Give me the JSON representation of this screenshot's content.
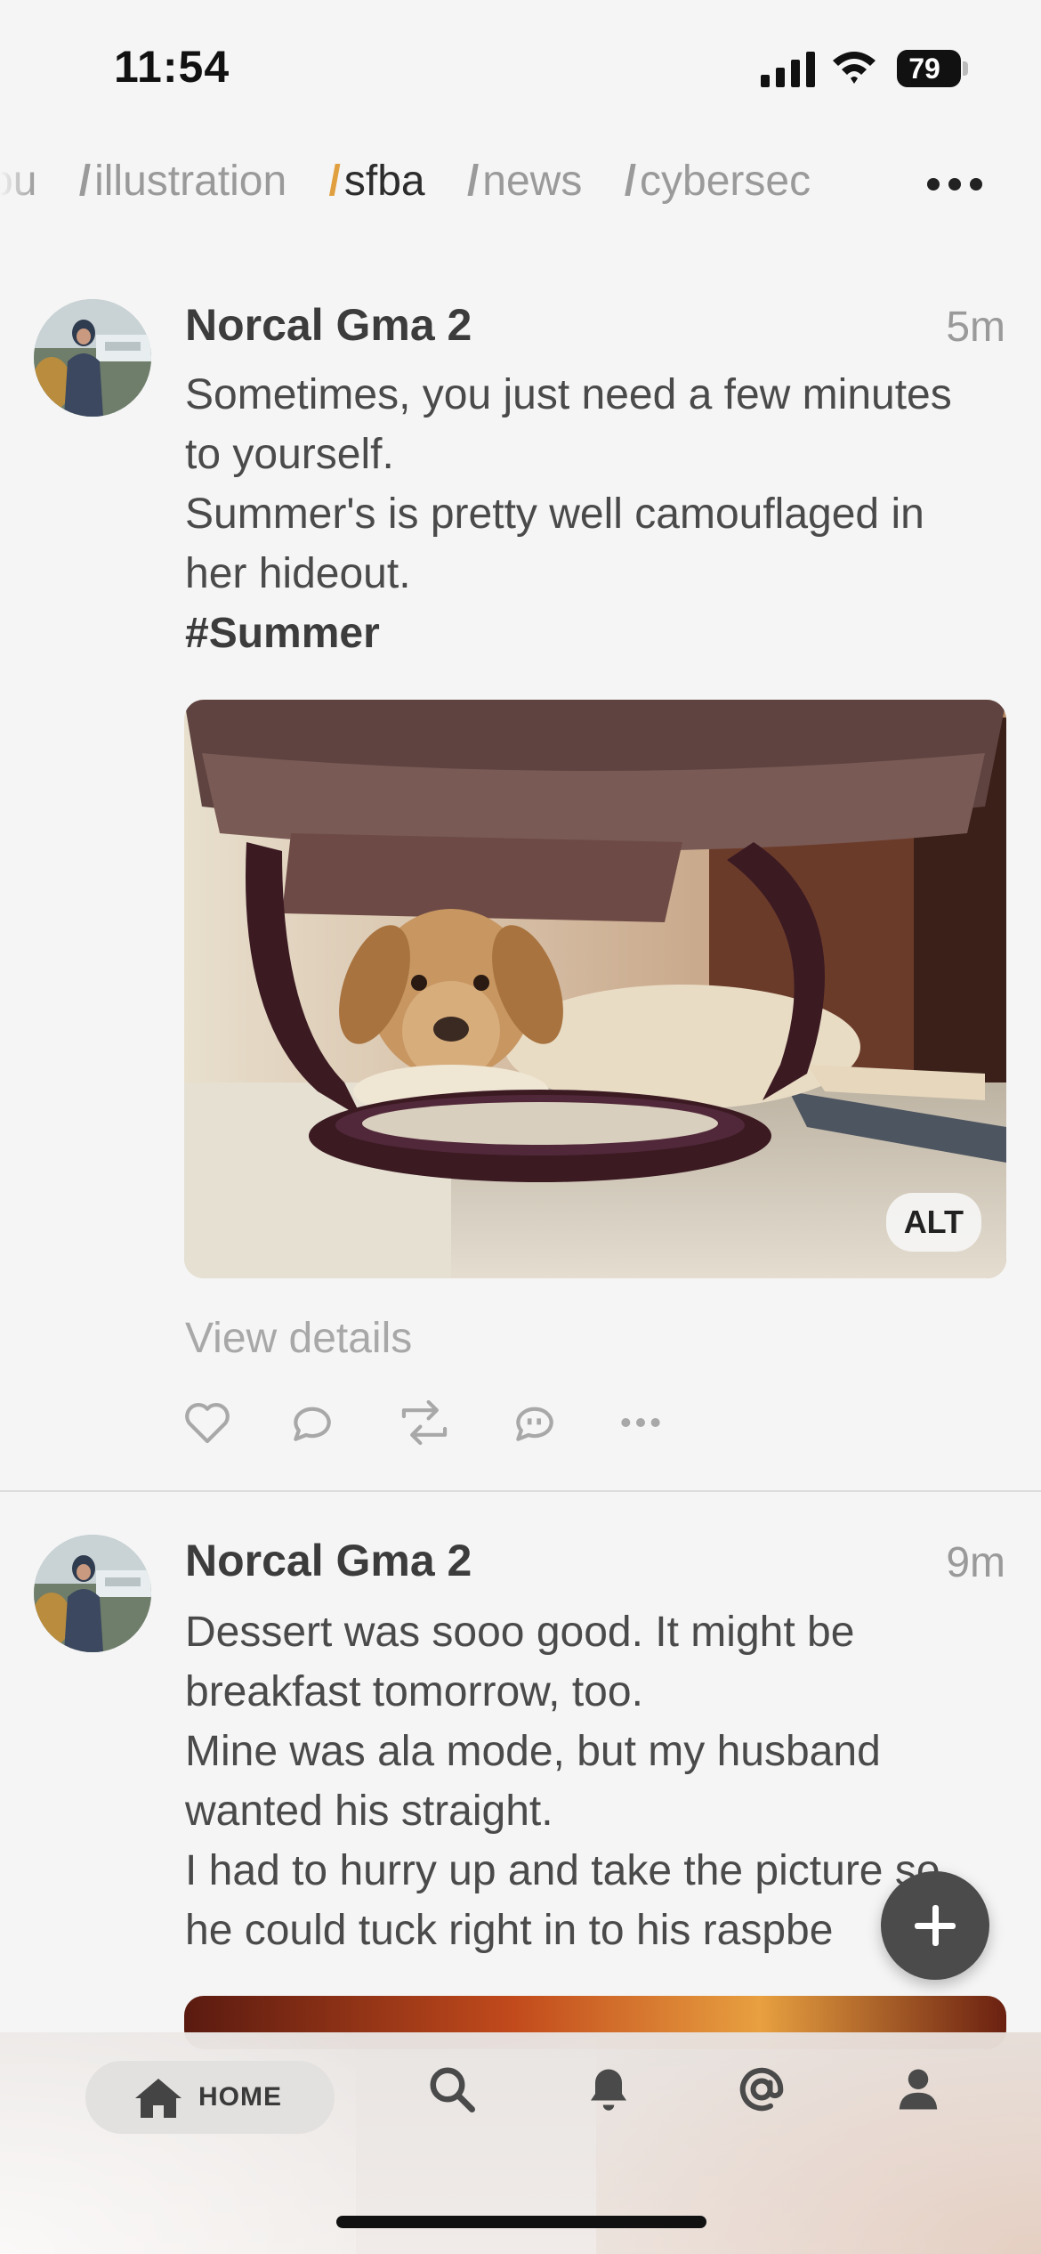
{
  "status_bar": {
    "time": "11:54",
    "battery": "79"
  },
  "feed_tabs": [
    {
      "label": "ou",
      "active": false
    },
    {
      "label": "illustration",
      "active": false
    },
    {
      "label": "sfba",
      "active": true
    },
    {
      "label": "news",
      "active": false
    },
    {
      "label": "cybersec",
      "active": false
    }
  ],
  "feed_tabs_more_icon": "more-horizontal-icon",
  "posts": [
    {
      "author": "Norcal Gma 2",
      "time": "5m",
      "lines": [
        "Sometimes, you just need a few minutes",
        "to yourself.",
        "Summer's is pretty well camouflaged in",
        "her hideout."
      ],
      "hashtag": "#Summer",
      "media_alt_badge": "ALT",
      "view_details": "View details"
    },
    {
      "author": "Norcal Gma 2",
      "time": "9m",
      "lines": [
        "Dessert was sooo good. It might be",
        "breakfast tomorrow, too.",
        "Mine was ala mode, but my husband",
        "wanted his straight.",
        "I had to hurry up and take the picture so",
        "he could tuck right in to his raspbe"
      ]
    }
  ],
  "tab_bar": {
    "home_label": "HOME",
    "items": [
      "home-icon",
      "search-icon",
      "bell-icon",
      "at-sign-icon",
      "profile-icon"
    ]
  },
  "colors": {
    "background": "#f5f5f5",
    "active_slash": "#e0a040",
    "fab": "#4b4b4b",
    "text_primary": "#3c3c3c",
    "text_muted": "#9a9a9a"
  }
}
